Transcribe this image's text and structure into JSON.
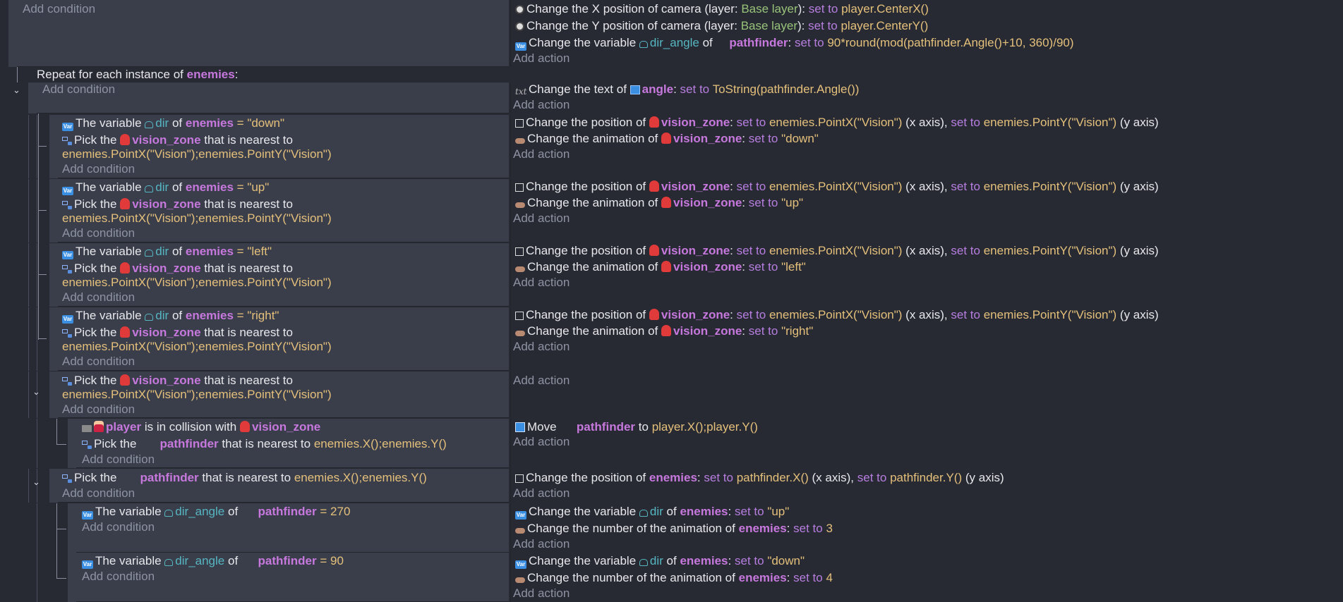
{
  "add_condition": "Add condition",
  "add_action": "Add action",
  "camera_event": {
    "a1": {
      "pre": "Change the X position of camera",
      "mid": "(layer: ",
      "layer": "Base layer",
      "post": "):",
      "kw": "set to",
      "val": "player.CenterX()"
    },
    "a2": {
      "pre": "Change the Y position of camera",
      "mid": "(layer: ",
      "layer": "Base layer",
      "post": "):",
      "kw": "set to",
      "val": "player.CenterY()"
    },
    "a3": {
      "pre": "Change the variable",
      "var": "dir_angle",
      "of": "of",
      "obj": "pathfinder",
      "colon": ":",
      "kw": "set to",
      "val": "90*round(mod(pathfinder.Angle()+10, 360)/90)"
    }
  },
  "repeat": {
    "pre": "Repeat for each instance of",
    "obj": "enemies",
    "post": ":"
  },
  "text_event": {
    "pre": "Change the text of",
    "obj": "angle",
    "colon": ":",
    "kw": "set to",
    "val": "ToString(pathfinder.Angle())"
  },
  "dir_events": [
    {
      "cond_pre": "The variable",
      "var": "dir",
      "of": "of",
      "obj": "enemies",
      "eq": "=",
      "cval": "\"down\"",
      "anim": "\"down\""
    },
    {
      "cond_pre": "The variable",
      "var": "dir",
      "of": "of",
      "obj": "enemies",
      "eq": "=",
      "cval": "\"up\"",
      "anim": "\"up\""
    },
    {
      "cond_pre": "The variable",
      "var": "dir",
      "of": "of",
      "obj": "enemies",
      "eq": "=",
      "cval": "\"left\"",
      "anim": "\"left\""
    },
    {
      "cond_pre": "The variable",
      "var": "dir",
      "of": "of",
      "obj": "enemies",
      "eq": "=",
      "cval": "\"right\"",
      "anim": "\"right\""
    }
  ],
  "pick": {
    "pre": "Pick the",
    "obj": "vision_zone",
    "post": "that is nearest to",
    "val": "enemies.PointX(\"Vision\");enemies.PointY(\"Vision\")"
  },
  "pos": {
    "pre": "Change the position of",
    "obj": "vision_zone",
    "colon": ":",
    "kw1": "set to",
    "val1": "enemies.PointX(\"Vision\")",
    "ax1": "(x axis),",
    "kw2": "set to",
    "val2": "enemies.PointY(\"Vision\")",
    "ax2": "(y axis)"
  },
  "anim": {
    "pre": "Change the animation of",
    "obj": "vision_zone",
    "colon": ":",
    "kw": "set to"
  },
  "collision": {
    "obj1": "player",
    "mid": "is in collision with",
    "obj2": "vision_zone"
  },
  "pick_pf": {
    "pre": "Pick the",
    "obj": "pathfinder",
    "post": "that is nearest to",
    "val": "enemies.X();enemies.Y()"
  },
  "move": {
    "pre": "Move",
    "obj": "pathfinder",
    "mid": "to",
    "val": "player.X();player.Y()"
  },
  "pos_enemies": {
    "pre": "Change the position of",
    "obj": "enemies",
    "colon": ":",
    "kw1": "set to",
    "val1": "pathfinder.X()",
    "ax1": "(x axis),",
    "kw2": "set to",
    "val2": "pathfinder.Y()",
    "ax2": "(y axis)"
  },
  "angle_events": [
    {
      "cond_pre": "The variable",
      "var": "dir_angle",
      "of": "of",
      "obj": "pathfinder",
      "eq": "=",
      "cval": "270",
      "a1": {
        "pre": "Change the variable",
        "var": "dir",
        "of": "of",
        "obj": "enemies",
        "colon": ":",
        "kw": "set to",
        "val": "\"up\""
      },
      "a2": {
        "pre": "Change the number of the animation of",
        "obj": "enemies",
        "colon": ":",
        "kw": "set to",
        "val": "3"
      }
    },
    {
      "cond_pre": "The variable",
      "var": "dir_angle",
      "of": "of",
      "obj": "pathfinder",
      "eq": "=",
      "cval": "90",
      "a1": {
        "pre": "Change the variable",
        "var": "dir",
        "of": "of",
        "obj": "enemies",
        "colon": ":",
        "kw": "set to",
        "val": "\"down\""
      },
      "a2": {
        "pre": "Change the number of the animation of",
        "obj": "enemies",
        "colon": ":",
        "kw": "set to",
        "val": "4"
      }
    }
  ]
}
